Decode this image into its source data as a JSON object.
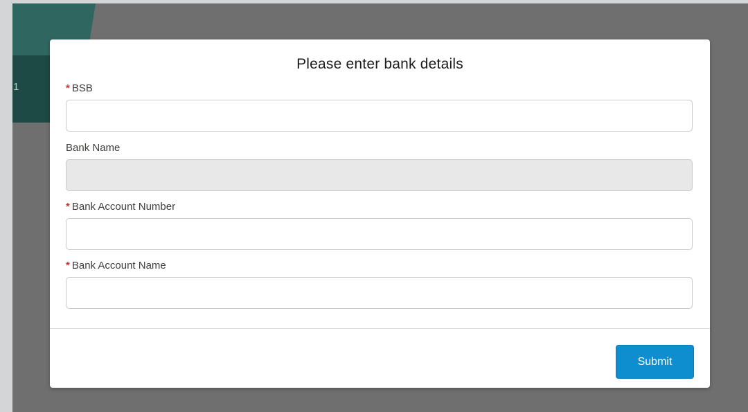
{
  "background": {
    "banner_number": "1"
  },
  "modal": {
    "title": "Please enter bank details",
    "fields": [
      {
        "label": "BSB",
        "required": true,
        "value": "",
        "readonly": false
      },
      {
        "label": "Bank Name",
        "required": false,
        "value": "",
        "readonly": true
      },
      {
        "label": "Bank Account Number",
        "required": true,
        "value": "",
        "readonly": false
      },
      {
        "label": "Bank Account Name",
        "required": true,
        "value": "",
        "readonly": false
      }
    ],
    "required_marker": "*",
    "submit_label": "Submit"
  },
  "colors": {
    "accent": "#0f8ecf",
    "required": "#c23934",
    "overlay": "#6f6f6f",
    "banner": "#1d4a45"
  }
}
